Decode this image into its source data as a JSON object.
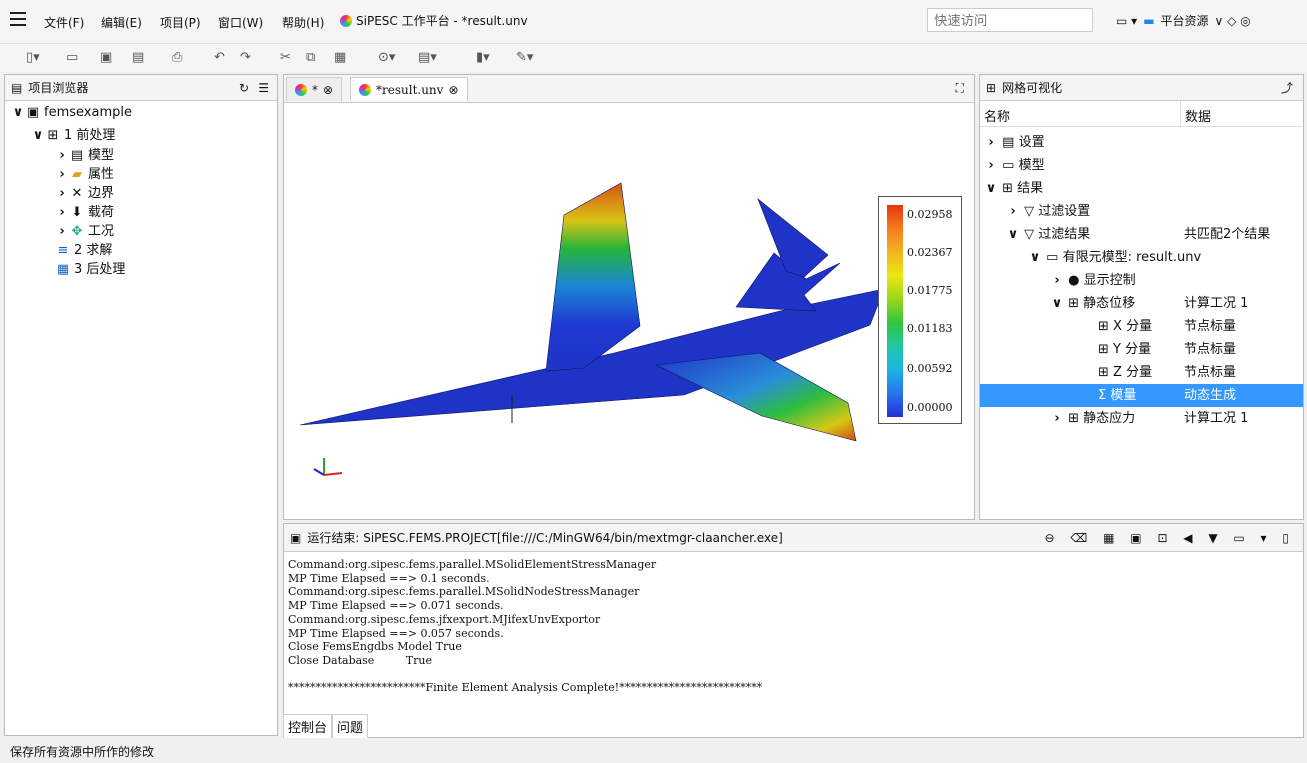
{
  "menu": {
    "items": [
      "文件(F)",
      "编辑(E)",
      "项目(P)",
      "窗口(W)",
      "帮助(H)"
    ],
    "app_title": "SiPESC 工作平台 - *result.unv",
    "quick_access_placeholder": "快速访问",
    "perspective": "平台资源"
  },
  "project_browser": {
    "title": "项目浏览器",
    "root": "femsexample",
    "pre": "1 前处理",
    "pre_children": [
      "模型",
      "属性",
      "边界",
      "载荷",
      "工况"
    ],
    "solve": "2 求解",
    "post": "3 后处理"
  },
  "editor": {
    "tabs": [
      "*",
      "*result.unv"
    ]
  },
  "legend": {
    "values": [
      "0.02958",
      "0.02367",
      "0.01775",
      "0.01183",
      "0.00592",
      "0.00000"
    ]
  },
  "mesh_viz": {
    "title": "网格可视化",
    "col_name": "名称",
    "col_data": "数据",
    "rows": [
      {
        "name": "设置",
        "data": ""
      },
      {
        "name": "模型",
        "data": ""
      },
      {
        "name": "结果",
        "data": ""
      },
      {
        "name": "过滤设置",
        "data": ""
      },
      {
        "name": "过滤结果",
        "data": "共匹配2个结果"
      },
      {
        "name": "有限元模型: result.unv",
        "data": ""
      },
      {
        "name": "显示控制",
        "data": ""
      },
      {
        "name": "静态位移",
        "data": "计算工况 1"
      },
      {
        "name": "X 分量",
        "data": "节点标量"
      },
      {
        "name": "Y 分量",
        "data": "节点标量"
      },
      {
        "name": "Z 分量",
        "data": "节点标量"
      },
      {
        "name": "模量",
        "data": "动态生成"
      },
      {
        "name": "静态应力",
        "data": "计算工况 1"
      }
    ]
  },
  "console": {
    "title": "运行结束: SiPESC.FEMS.PROJECT[file:///C:/MinGW64/bin/mextmgr-claancher.exe]",
    "lines": "Command:org.sipesc.fems.parallel.MSolidElementStressManager\nMP Time Elapsed ==> 0.1 seconds.\nCommand:org.sipesc.fems.parallel.MSolidNodeStressManager\nMP Time Elapsed ==> 0.071 seconds.\nCommand:org.sipesc.fems.jfxexport.MJifexUnvExportor\nMP Time Elapsed ==> 0.057 seconds.\nClose FemsEngdbs Model True\nClose Database         True\n\n*************************Finite Element Analysis Complete!**************************",
    "tabs": [
      "控制台",
      "问题"
    ]
  },
  "status": {
    "text": "保存所有资源中所作的修改"
  }
}
